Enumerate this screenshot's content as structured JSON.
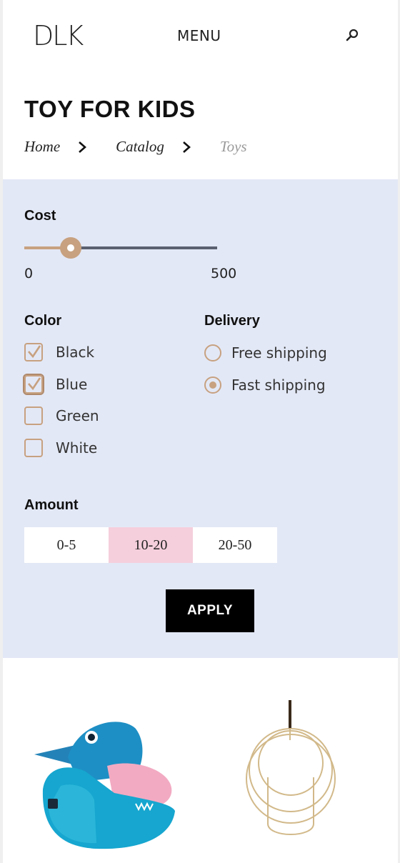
{
  "header": {
    "logo": "DLK",
    "menu_label": "MENU"
  },
  "page": {
    "title": "TOY FOR KIDS",
    "breadcrumb": [
      "Home",
      "Catalog",
      "Toys"
    ]
  },
  "filters": {
    "cost": {
      "label": "Cost",
      "min_label": "0",
      "max_label": "500",
      "min": 0,
      "max": 500,
      "value": 120
    },
    "color": {
      "label": "Color",
      "options": [
        {
          "label": "Black",
          "checked": true
        },
        {
          "label": "Blue",
          "checked": true
        },
        {
          "label": "Green",
          "checked": false
        },
        {
          "label": "White",
          "checked": false
        }
      ]
    },
    "delivery": {
      "label": "Delivery",
      "options": [
        {
          "label": "Free shipping",
          "selected": false
        },
        {
          "label": "Fast shipping",
          "selected": true
        }
      ]
    },
    "amount": {
      "label": "Amount",
      "options": [
        "0-5",
        "10-20",
        "20-50"
      ],
      "selected_index": 1
    },
    "apply_label": "APPLY"
  },
  "colors": {
    "accent": "#c7a180",
    "panel_bg": "#e3e8f6",
    "selected_amount_bg": "#f5cfdc",
    "button_bg": "#000000"
  },
  "products": [
    {
      "icon": "shark-bean-bag-image"
    },
    {
      "icon": "gold-ring-ornament-image"
    }
  ]
}
